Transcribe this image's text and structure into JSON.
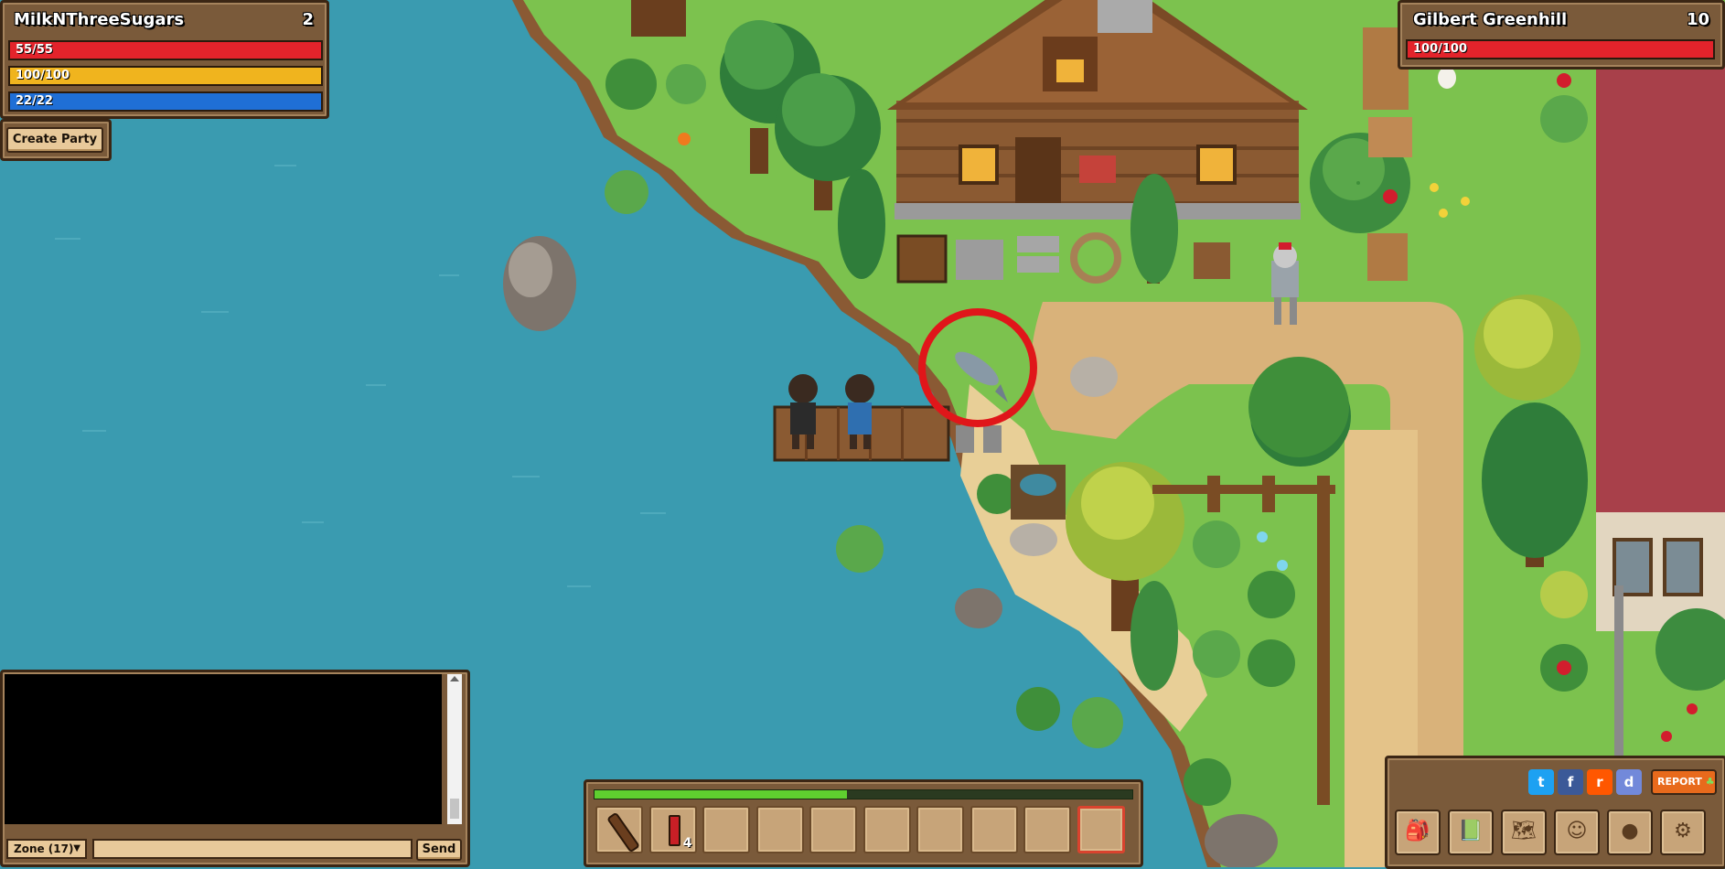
{
  "player": {
    "name": "MilkNThreeSugars",
    "level": "2",
    "health": "55/55",
    "energy": "100/100",
    "mana": "22/22",
    "health_fraction": 1.0,
    "energy_fraction": 1.0,
    "mana_fraction": 1.0
  },
  "party": {
    "create_label": "Create Party"
  },
  "target": {
    "name": "Gilbert Greenhill",
    "level": "10",
    "health": "100/100",
    "health_fraction": 1.0
  },
  "chat": {
    "channel_selected": "Zone (17)",
    "input_value": "",
    "send_label": "Send"
  },
  "hotbar": {
    "xp_fraction": 0.47,
    "slots": [
      {
        "item": "wooden-club",
        "count": ""
      },
      {
        "item": "red-potion",
        "count": "4"
      },
      {
        "item": "",
        "count": ""
      },
      {
        "item": "",
        "count": ""
      },
      {
        "item": "",
        "count": ""
      },
      {
        "item": "",
        "count": ""
      },
      {
        "item": "",
        "count": ""
      },
      {
        "item": "",
        "count": ""
      },
      {
        "item": "",
        "count": ""
      },
      {
        "item": "",
        "count": ""
      }
    ],
    "selected_index": 9
  },
  "menu": {
    "social": [
      "twitter-icon",
      "facebook-icon",
      "reddit-icon",
      "discord-icon"
    ],
    "report_label": "REPORT",
    "buttons": [
      "inventory-bag-icon",
      "quest-book-icon",
      "world-map-icon",
      "character-icon",
      "gold-coins-icon",
      "settings-gear-icon"
    ]
  },
  "colors": {
    "health": "#e3232b",
    "energy": "#f0b41e",
    "mana": "#1f6fd6",
    "xp": "#5fcf2f",
    "water": "#3a9bb0",
    "grass": "#7cc24e",
    "sand": "#e8cf97",
    "dirt": "#d9b27a",
    "highlight_ring": "#e0161a"
  }
}
